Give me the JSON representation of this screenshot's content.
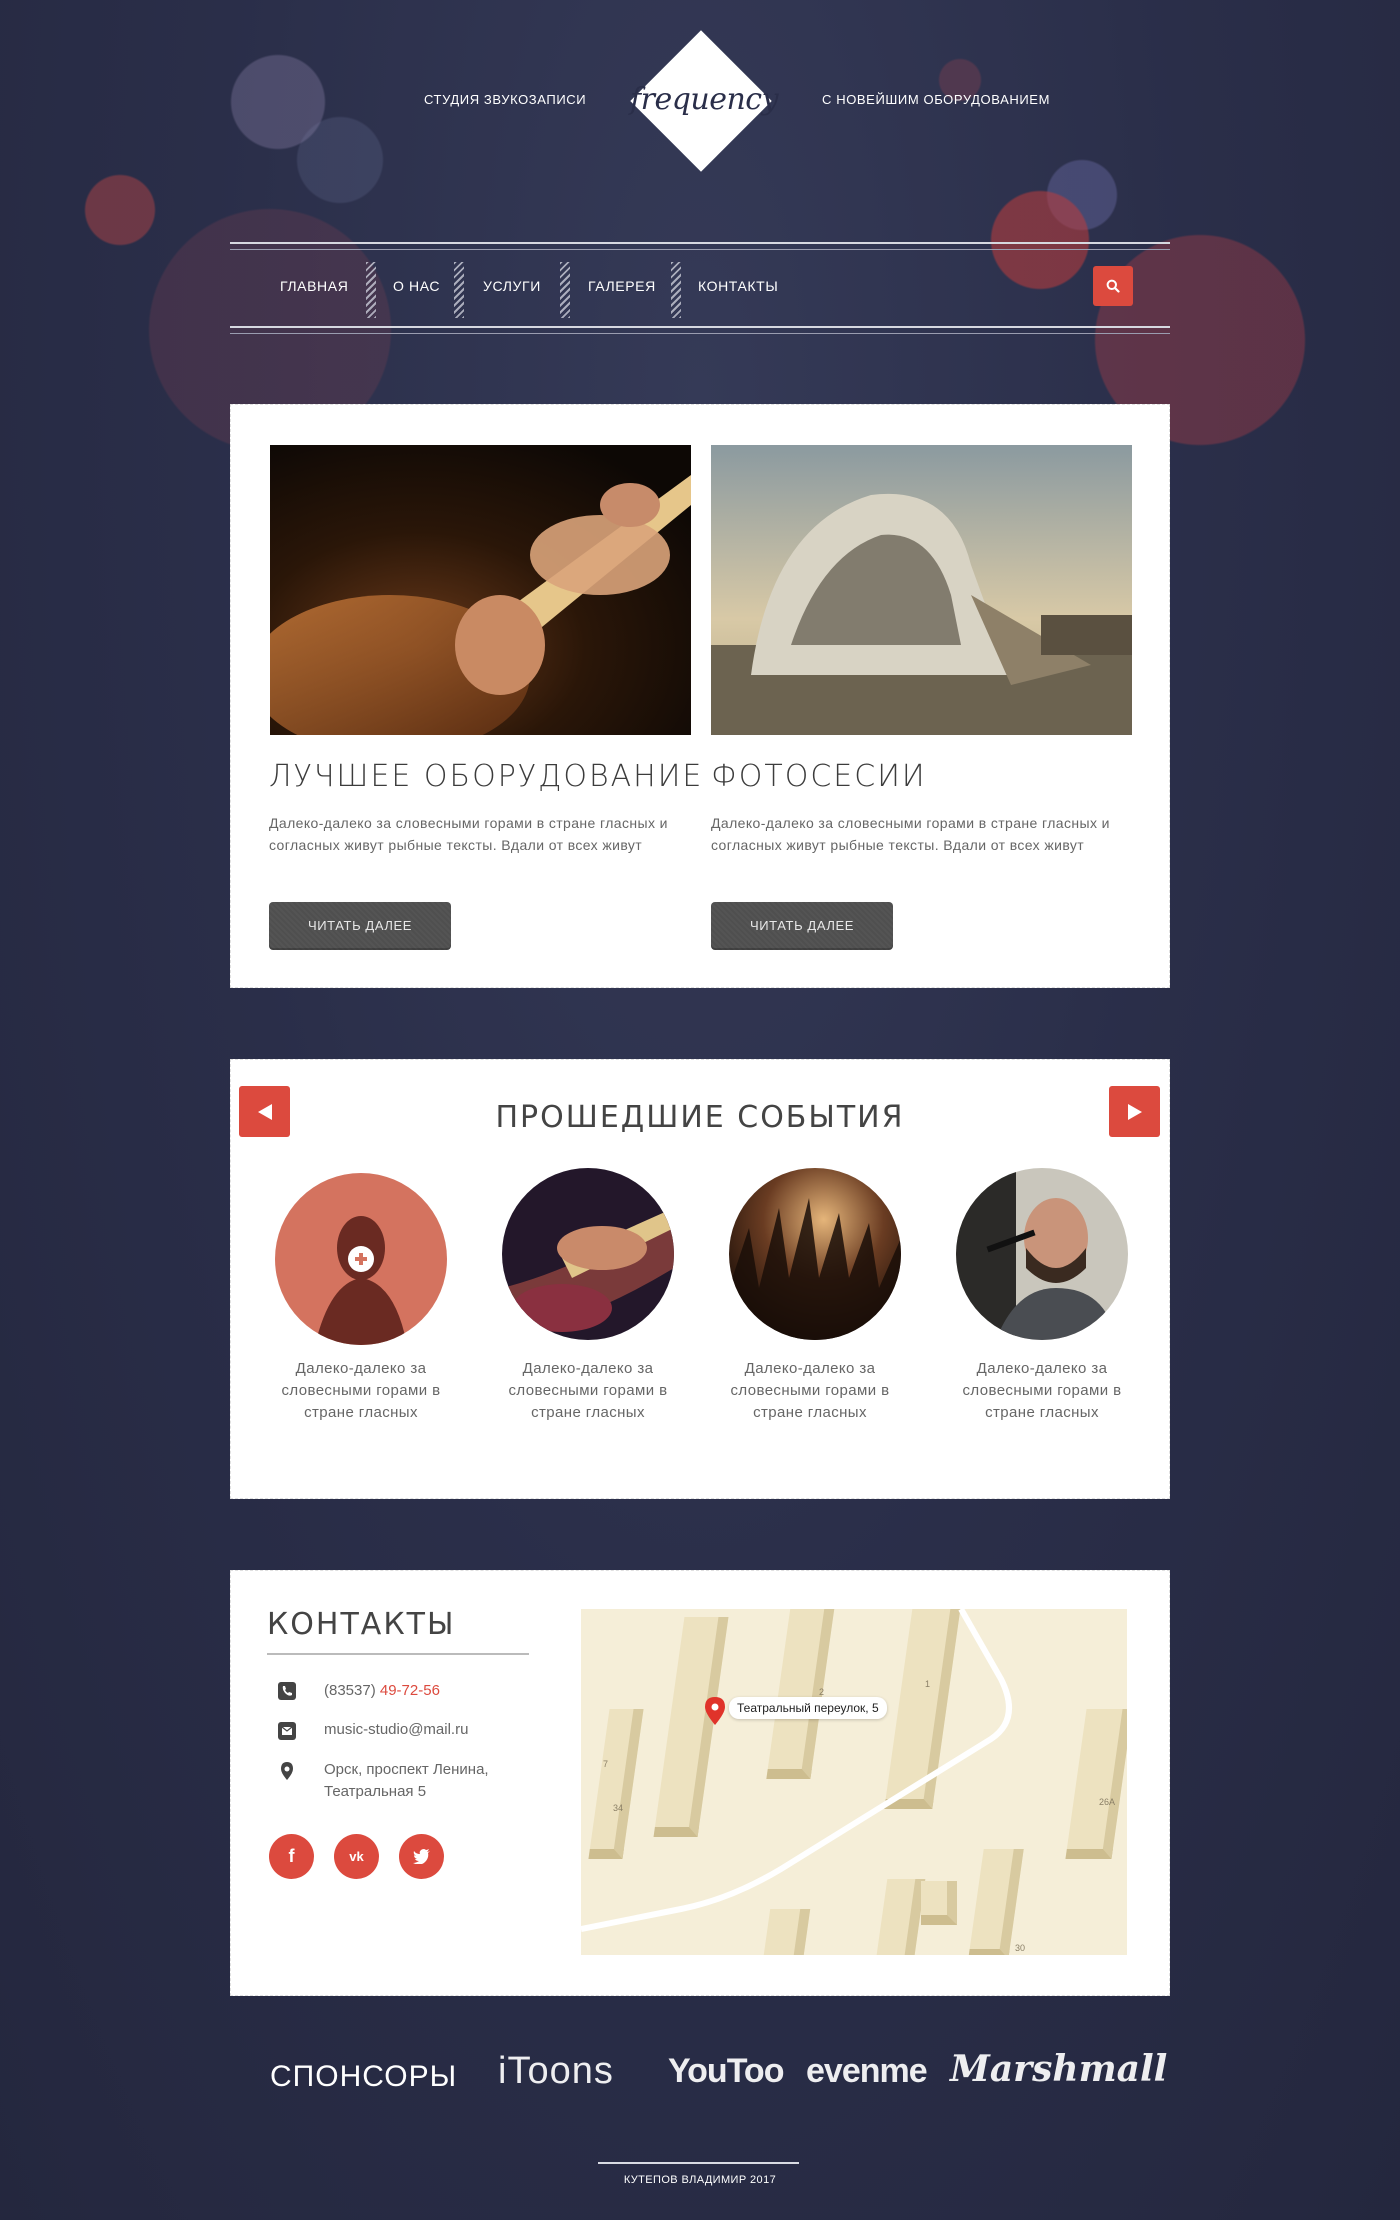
{
  "header": {
    "tagline_left": "СТУДИЯ ЗВУКОЗАПИСИ",
    "logo": "frequency",
    "tagline_right": "С  НОВЕЙШИМ ОБОРУДОВАНИЕМ"
  },
  "nav": {
    "items": [
      "ГЛАВНАЯ",
      "О НАС",
      "УСЛУГИ",
      "ГАЛЕРЕЯ",
      "КОНТАКТЫ"
    ],
    "search_icon": "search-icon"
  },
  "features": [
    {
      "title": "ЛУЧШЕЕ ОБОРУДОВАНИЕ",
      "text": "Далеко-далеко за словесными горами в стране гласных и согласных живут рыбные тексты. Вдали от всех живут",
      "button": "ЧИТАТЬ ДАЛЕЕ"
    },
    {
      "title": "ФОТОСЕСИИ",
      "text": "Далеко-далеко за словесными горами в стране гласных и согласных живут рыбные тексты. Вдали от всех живут",
      "button": "ЧИТАТЬ ДАЛЕЕ"
    }
  ],
  "events": {
    "title": "ПРОШЕДШИЕ СОБЫТИЯ",
    "prev_icon": "arrow-left-icon",
    "next_icon": "arrow-right-icon",
    "items": [
      {
        "text": "Далеко-далеко за словесными горами в стране гласных"
      },
      {
        "text": "Далеко-далеко за словесными горами в стране гласных"
      },
      {
        "text": "Далеко-далеко за словесными горами в стране гласных"
      },
      {
        "text": "Далеко-далеко за словесными горами в стране гласных"
      }
    ]
  },
  "contacts": {
    "title": "КОНТАКТЫ",
    "phone_code": "(83537)",
    "phone_number": "49-72-56",
    "email": "music-studio@mail.ru",
    "address_line1": "Орск, проспект Ленина,",
    "address_line2": "Театральная 5",
    "social": [
      "f",
      "vk",
      "twitter"
    ],
    "map": {
      "address": "Театральный переулок, 5",
      "labels": [
        "7",
        "34",
        "1",
        "2",
        "26А",
        "30"
      ]
    }
  },
  "sponsors": {
    "title": "СПОНСОРЫ",
    "items": [
      "iToons",
      "YouToo",
      "evenme",
      "Marshmall"
    ]
  },
  "footer": {
    "text": "КУТЕПОВ ВЛАДИМИР 2017"
  },
  "colors": {
    "accent": "#dc4a3e",
    "background": "#272b45",
    "button": "#4f4f4f"
  }
}
